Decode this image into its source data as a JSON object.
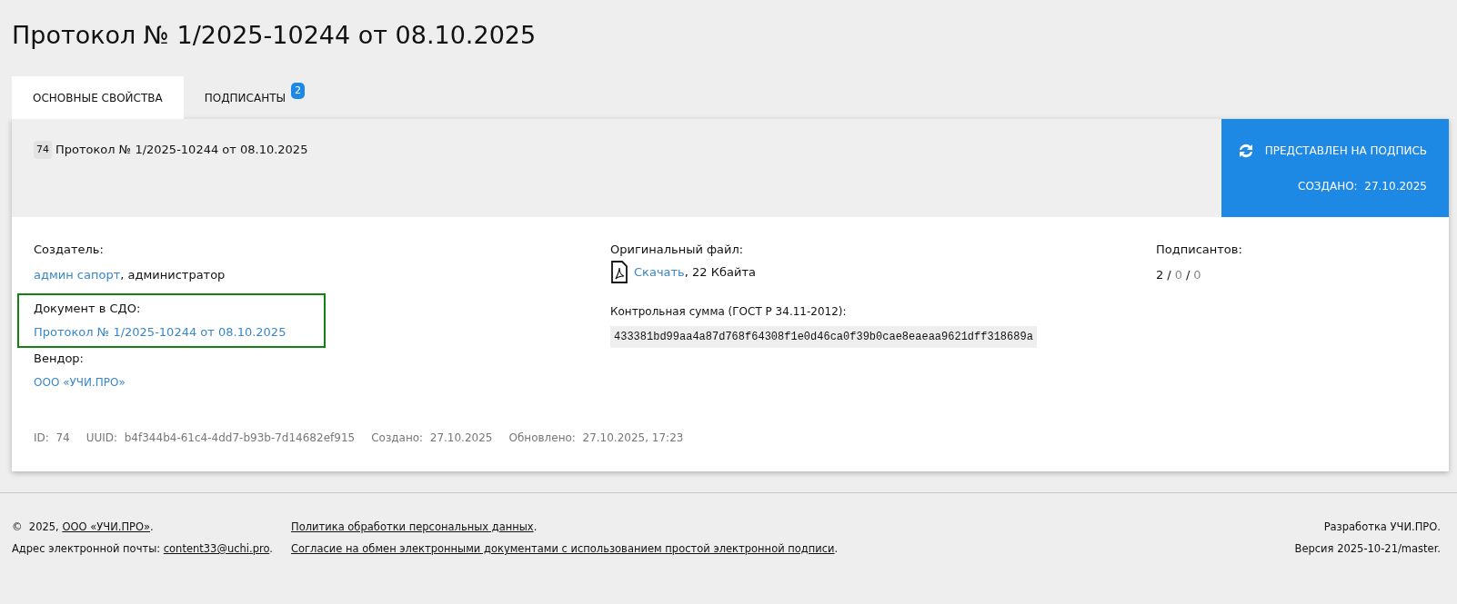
{
  "title": "Протокол № 1/2025-10244 от 08.10.2025",
  "tabs": [
    {
      "label": "ОСНОВНЫЕ СВОЙСТВА",
      "selected": true
    },
    {
      "label": "ПОДПИСАНТЫ",
      "selected": false,
      "badge": "2"
    }
  ],
  "header": {
    "id_badge": "74",
    "name": "Протокол № 1/2025-10244 от 08.10.2025"
  },
  "status": {
    "label": "ПРЕДСТАВЛЕН НА ПОДПИСЬ",
    "created_label": "СОЗДАНО:",
    "created_value": "27.10.2025"
  },
  "fields": {
    "creator": {
      "label": "Создатель:",
      "link": "админ сапорт",
      "rest": ", администратор"
    },
    "document": {
      "label": "Документ в СДО:",
      "link": "Протокол № 1/2025-10244 от 08.10.2025",
      "highlighted": true
    },
    "vendor": {
      "label": "Вендор:",
      "link": "ООО «УЧИ.ПРО»"
    },
    "file": {
      "label": "Оригинальный файл:",
      "link": "Скачать",
      "rest": ", 22 Кбайта"
    },
    "checksum": {
      "label": "Контрольная сумма (ГОСТ Р 34.11-2012):",
      "value": "433381bd99aa4a87d768f64308f1e0d46ca0f39b0cae8eaeaa9621dff318689a"
    },
    "signers": {
      "label": "Подписантов:",
      "separator": "/",
      "counts": [
        {
          "value": "2",
          "kind": "main"
        },
        {
          "value": "0",
          "kind": "muted"
        },
        {
          "value": "0",
          "kind": "muted"
        }
      ]
    }
  },
  "meta": [
    {
      "label": "ID:",
      "value": "74"
    },
    {
      "label": "UUID:",
      "value": "b4f344b4-61c4-4dd7-b93b-7d14682ef915"
    },
    {
      "label": "Создано:",
      "value": "27.10.2025"
    },
    {
      "label": "Обновлено:",
      "value": "27.10.2025, 17:23"
    }
  ],
  "footer": {
    "copyright": {
      "prefix": "©  2025, ",
      "link": "ООО «УЧИ.ПРО»",
      "suffix": "."
    },
    "email": {
      "prefix": "Адрес электронной почты: ",
      "link": "content33@uchi.pro",
      "suffix": "."
    },
    "policy": {
      "link": "Политика обработки персональных данных",
      "suffix": "."
    },
    "consent": {
      "link": "Согласие на обмен электронными документами с использованием простой электронной подписи",
      "suffix": "."
    },
    "developer": "Разработка УЧИ.ПРО.",
    "version": "Версия 2025-10-21/master."
  }
}
